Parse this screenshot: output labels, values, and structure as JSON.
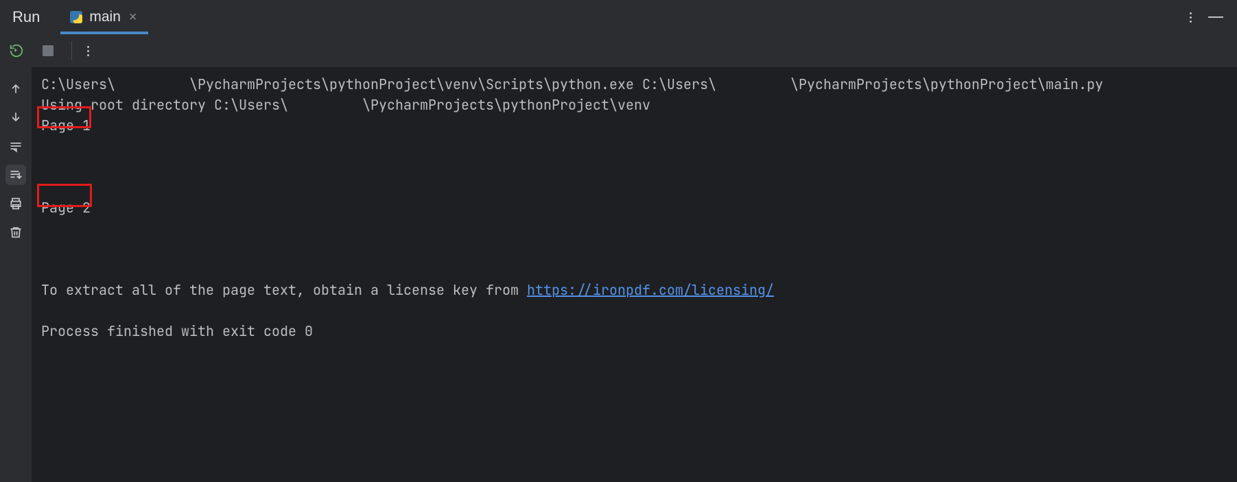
{
  "header": {
    "panel_title": "Run",
    "tab_label": "main"
  },
  "console": {
    "line1_a": "C:\\Users\\",
    "line1_b": "\\PycharmProjects\\pythonProject\\venv\\Scripts\\python.exe C:\\Users\\",
    "line1_c": "\\PycharmProjects\\pythonProject\\main.py",
    "line2_a": "Using root directory C:\\Users\\",
    "line2_b": "",
    "line2_c": "\\PycharmProjects\\pythonProject\\venv",
    "page1": "Page 1",
    "page2": "Page 2",
    "license_prefix": "To extract all of the page text, obtain a license key from ",
    "license_link": "https://ironpdf.com/licensing/",
    "exit_line": "Process finished with exit code 0"
  }
}
